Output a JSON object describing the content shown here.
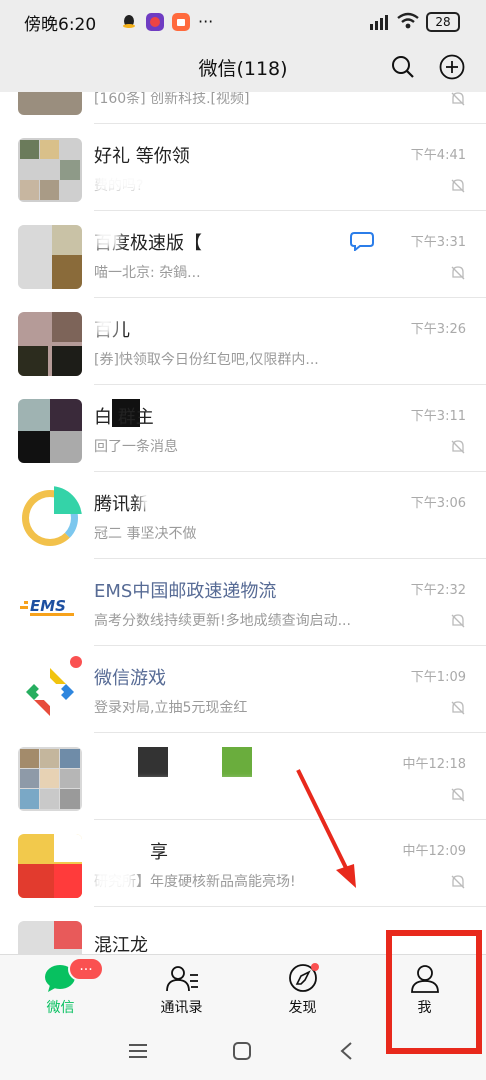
{
  "status": {
    "time": "傍晚6:20",
    "battery": "28",
    "more": "···"
  },
  "header": {
    "title": "微信(118)"
  },
  "chats": [
    {
      "name": "",
      "preview": "[160条] 创新科技.[视频]",
      "time": ""
    },
    {
      "name": "好礼 等你领",
      "preview": "费的吗?",
      "time": "下午4:41"
    },
    {
      "name": "百度极速版【",
      "preview": "喵一北京:  杂鍋...",
      "time": "下午3:31"
    },
    {
      "name": "百儿",
      "preview": "[券]快领取今日份红包吧,仅限群内...",
      "time": "下午3:26"
    },
    {
      "name": "白  群主",
      "preview": "回了一条消息",
      "time": "下午3:11"
    },
    {
      "name": "腾讯新",
      "preview": "冠二  事坚决不做",
      "time": "下午3:06"
    },
    {
      "name": "EMS中国邮政速递物流",
      "preview": "高考分数线持续更新!多地成绩查询启动...",
      "time": "下午2:32"
    },
    {
      "name": "微信游戏",
      "preview": "登录对局,立抽5元现金红",
      "time": "下午1:09"
    },
    {
      "name": "",
      "preview": "",
      "time": "中午12:18"
    },
    {
      "name": "享",
      "preview": "研究所】年度硬核新品高能亮场!",
      "time": "中午12:09"
    },
    {
      "name": "混江龙",
      "preview": "",
      "time": ""
    }
  ],
  "tabs": [
    {
      "label": "微信",
      "badge": "···",
      "active": true
    },
    {
      "label": "通讯录"
    },
    {
      "label": "发现"
    },
    {
      "label": "我"
    }
  ],
  "colors": {
    "accent": "#07c160",
    "badge": "#fa5151",
    "annotation": "#e8291c"
  }
}
